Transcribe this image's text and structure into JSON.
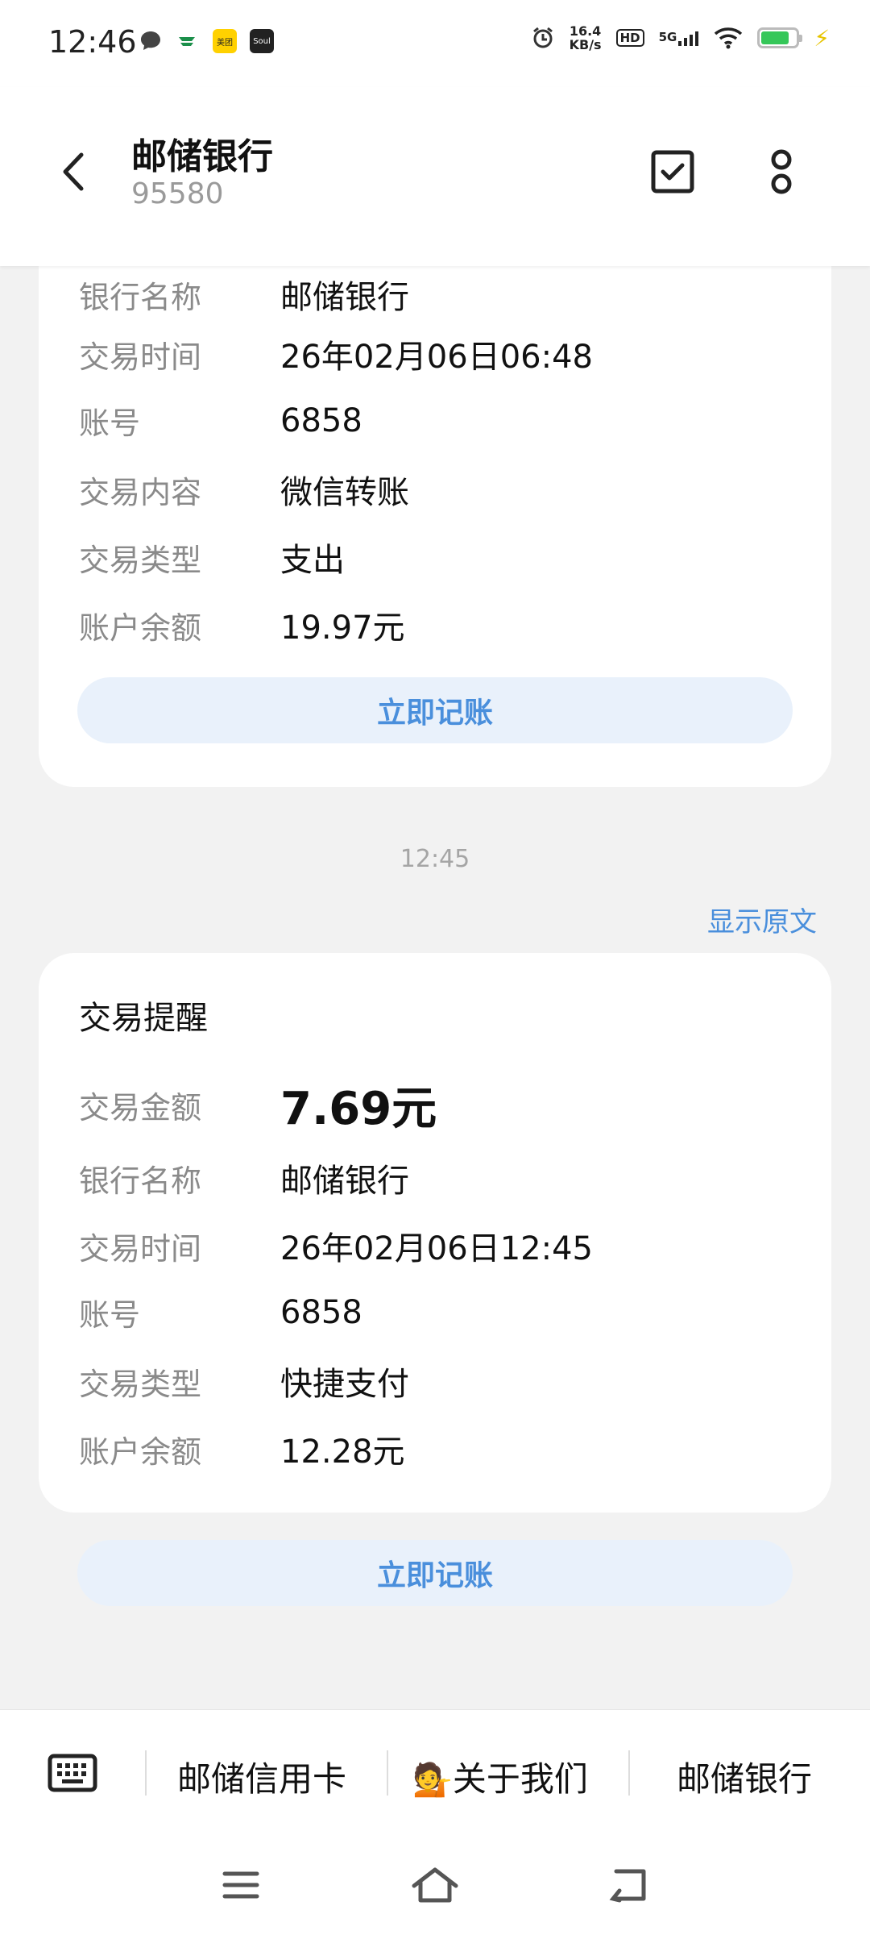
{
  "status_bar": {
    "time": "12:46",
    "net_speed_value": "16.4",
    "net_speed_unit": "KB/s",
    "hd_label": "HD",
    "signal_label": "5G",
    "battery_level": 0.8,
    "app_icon_meituan_text": "美团",
    "app_icon_soul_text": "Soul"
  },
  "header": {
    "contact_name": "邮储银行",
    "contact_number": "95580"
  },
  "card1": {
    "rows": [
      {
        "label": "交易时间",
        "value": "26年02月06日06:48"
      },
      {
        "label": "账号",
        "value": "6858"
      },
      {
        "label": "交易内容",
        "value": "微信转账"
      },
      {
        "label": "交易类型",
        "value": "支出"
      },
      {
        "label": "账户余额",
        "value": "19.97元"
      }
    ],
    "button_label": "立即记账"
  },
  "message_time": "12:45",
  "show_original_label": "显示原文",
  "card2": {
    "title": "交易提醒",
    "amount_label": "交易金额",
    "amount_value": "7.69元",
    "rows": [
      {
        "label": "银行名称",
        "value": "邮储银行"
      },
      {
        "label": "交易时间",
        "value": "26年02月06日12:45"
      },
      {
        "label": "账号",
        "value": "6858"
      },
      {
        "label": "交易类型",
        "value": "快捷支付"
      },
      {
        "label": "账户余额",
        "value": "12.28元"
      }
    ],
    "button_label": "立即记账"
  },
  "bottom_menu": {
    "item1": "邮储信用卡",
    "item2_emoji": "💁",
    "item2": "关于我们",
    "item3": "邮储银行"
  },
  "colors": {
    "accent": "#4a8fdc",
    "button_bg": "#e9f1fb",
    "page_bg": "#f2f2f2",
    "battery": "#35c759"
  },
  "icons": [
    "message-bubble-icon",
    "china-post-icon",
    "meituan-icon",
    "soul-icon",
    "alarm-icon",
    "wifi-icon",
    "battery-icon",
    "back-icon",
    "checkbox-icon",
    "more-icon",
    "keyboard-icon",
    "menu-icon",
    "home-icon",
    "back-nav-icon"
  ]
}
